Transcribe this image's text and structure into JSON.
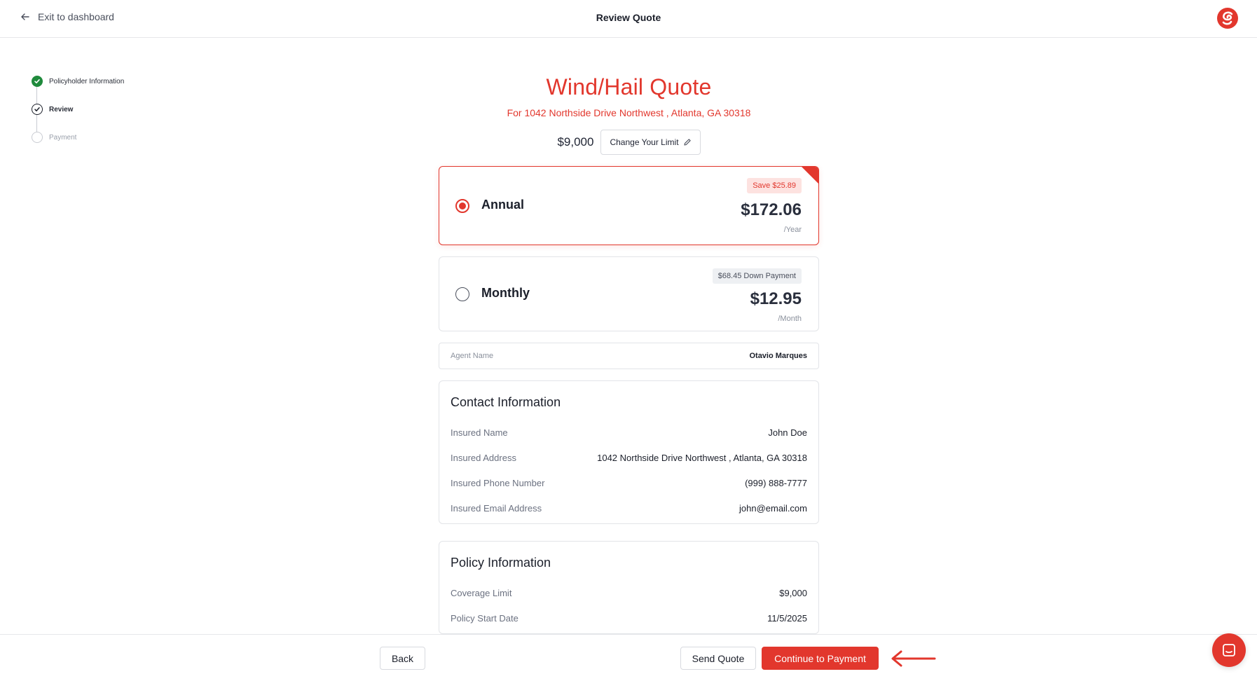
{
  "topbar": {
    "exit_label": "Exit to dashboard",
    "title": "Review Quote",
    "logo_icon": "brand-swirl-icon",
    "brand_color": "#e2372d"
  },
  "stepper": {
    "steps": [
      {
        "label": "Policyholder Information",
        "status": "completed"
      },
      {
        "label": "Review",
        "status": "current"
      },
      {
        "label": "Payment",
        "status": "upcoming"
      }
    ]
  },
  "quote": {
    "title": "Wind/Hail Quote",
    "subtitle": "For 1042 Northside Drive Northwest , Atlanta, GA 30318",
    "limit_value": "$9,000",
    "change_limit_label": "Change Your Limit"
  },
  "plans": [
    {
      "name": "Annual",
      "badge": "Save $25.89",
      "price": "$172.06",
      "period": "/Year",
      "selected": true
    },
    {
      "name": "Monthly",
      "badge": "$68.45 Down Payment",
      "price": "$12.95",
      "period": "/Month",
      "selected": false
    }
  ],
  "agent": {
    "label": "Agent Name",
    "value": "Otavio Marques"
  },
  "contact": {
    "heading": "Contact Information",
    "rows": [
      {
        "label": "Insured Name",
        "value": "John Doe"
      },
      {
        "label": "Insured Address",
        "value": "1042 Northside Drive Northwest , Atlanta, GA 30318"
      },
      {
        "label": "Insured Phone Number",
        "value": "(999) 888-7777"
      },
      {
        "label": "Insured Email Address",
        "value": "john@email.com"
      }
    ]
  },
  "policy": {
    "heading": "Policy Information",
    "rows": [
      {
        "label": "Coverage Limit",
        "value": "$9,000"
      },
      {
        "label": "Policy Start Date",
        "value": "11/5/2025"
      }
    ]
  },
  "footer": {
    "back_label": "Back",
    "send_label": "Send Quote",
    "continue_label": "Continue to Payment"
  }
}
